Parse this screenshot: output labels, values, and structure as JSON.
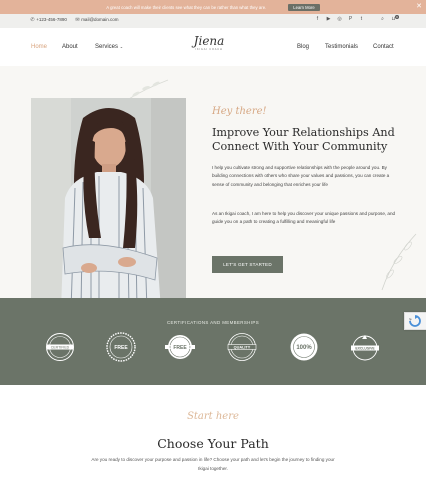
{
  "announcement": {
    "text": "A great coach will make their clients see what they can be rather than what they are.",
    "button_label": "Learn More",
    "close_icon": "close-icon"
  },
  "contact_bar": {
    "phone": "+123-456-7890",
    "email": "mail@domain.com",
    "social_icons": [
      "facebook-icon",
      "youtube-icon",
      "instagram-icon",
      "pinterest-icon",
      "twitter-icon"
    ],
    "cart_count": "0"
  },
  "nav": {
    "home": "Home",
    "about": "About",
    "services": "Services",
    "blog": "Blog",
    "testimonials": "Testimonials",
    "contact": "Contact"
  },
  "logo": {
    "name": "Jiena",
    "tagline": "IKIGAI COACH"
  },
  "hero": {
    "greeting": "Hey there!",
    "heading": "Improve Your Relationships And Connect With Your Community",
    "paragraph1": "I help you cultivate strong and supportive relationships with the people around you. By building connections with others who share your values and passions, you can create a sense of community and belonging that enriches your life",
    "paragraph2": "As an Ikigai coach, I am here to help you discover your unique passions and purpose, and guide you on a path to creating a fulfilling and meaningful life",
    "cta_label": "LET'S GET STARTED"
  },
  "certifications": {
    "title": "CERTIFICATIONS AND MEMBERSHIPS",
    "badges": [
      "CERTIFIED",
      "FREE",
      "FREE",
      "QUALITY",
      "100%",
      "EXCLUSIVE"
    ]
  },
  "path": {
    "script": "Start here",
    "heading": "Choose Your Path",
    "paragraph": "Are you ready to discover your purpose and passion in life? Choose your path and let's begin the journey to finding your Ikigai together."
  },
  "colors": {
    "announcement_bg": "#e3b39a",
    "accent_sage": "#6b7468",
    "accent_peach": "#d6a783"
  }
}
